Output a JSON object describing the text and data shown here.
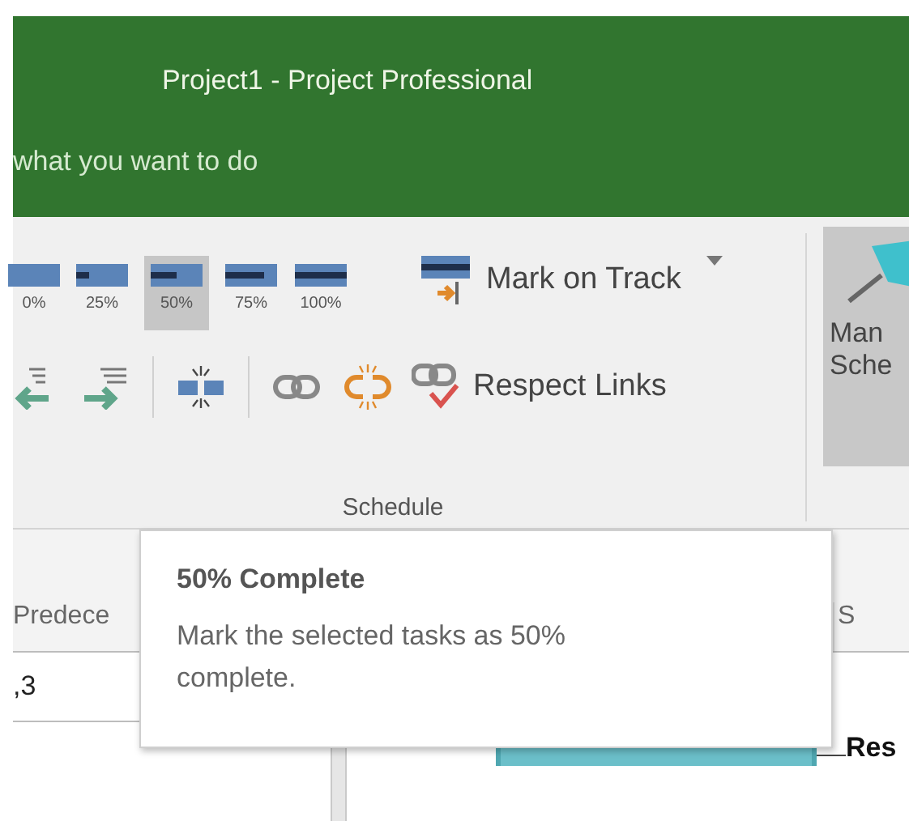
{
  "window": {
    "title": "Project1  -  Project Professional"
  },
  "tell_me": {
    "text": "what you want to do"
  },
  "ribbon": {
    "percent_buttons": [
      {
        "label": "0%",
        "level": 0,
        "selected": false
      },
      {
        "label": "25%",
        "level": 0.25,
        "selected": false
      },
      {
        "label": "50%",
        "level": 0.5,
        "selected": true
      },
      {
        "label": "75%",
        "level": 0.75,
        "selected": false
      },
      {
        "label": "100%",
        "level": 1,
        "selected": false
      }
    ],
    "mark_on_track": {
      "label": "Mark on Track"
    },
    "respect_links": {
      "label": "Respect Links"
    },
    "group_label": "Schedule",
    "manual_schedule": {
      "lines": [
        "Man",
        "Sche"
      ]
    }
  },
  "table": {
    "columns": [
      {
        "label": "Predece"
      },
      {
        "label": "S"
      }
    ],
    "rows": [
      {
        "cells": [
          ",3"
        ]
      }
    ]
  },
  "gantt": {
    "bars": [
      {
        "label": "Res"
      }
    ]
  },
  "tooltip": {
    "title": "50% Complete",
    "text": "Mark the selected tasks as 50% complete."
  }
}
